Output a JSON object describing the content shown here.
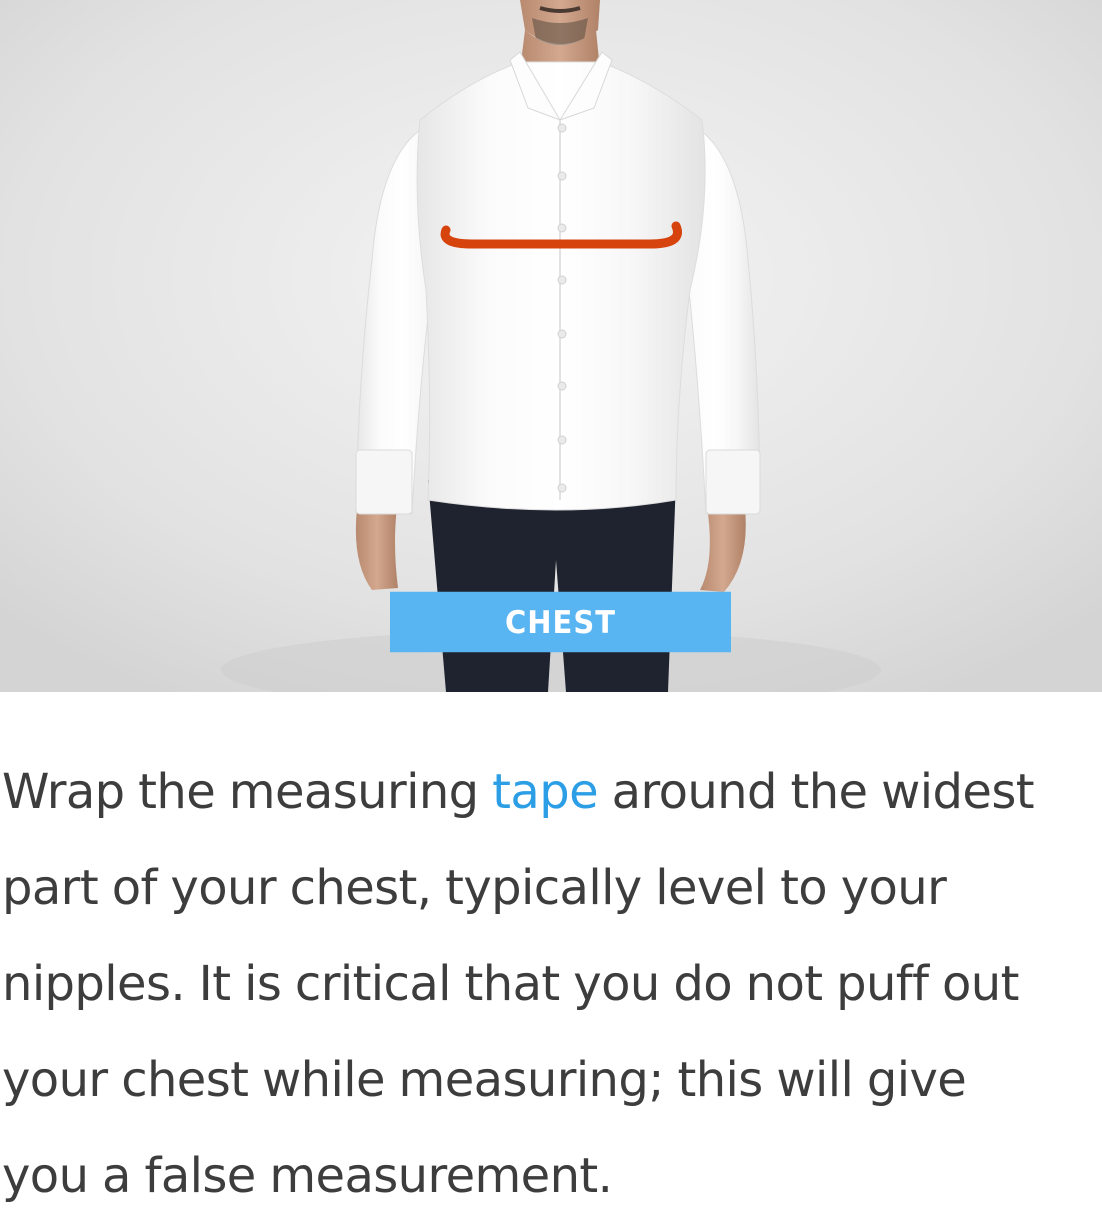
{
  "figure": {
    "image_alt": "Man in a white dress shirt with the chest measurement line shown",
    "label": "CHEST",
    "colors": {
      "label_background": "#59b4f2",
      "measurement_line": "#d6430d"
    }
  },
  "instructions": {
    "lines": [
      {
        "before": "Wrap the measuring ",
        "link": "tape",
        "after": " around the widest"
      },
      {
        "text": "part of your chest, typically level to your"
      },
      {
        "text": "nipples. It is critical that you do not puff out"
      },
      {
        "text": "your chest while measuring; this will give"
      },
      {
        "text": "you a false measurement."
      }
    ],
    "link_color": "#2b9ee6",
    "text_color": "#3d3d3d"
  }
}
